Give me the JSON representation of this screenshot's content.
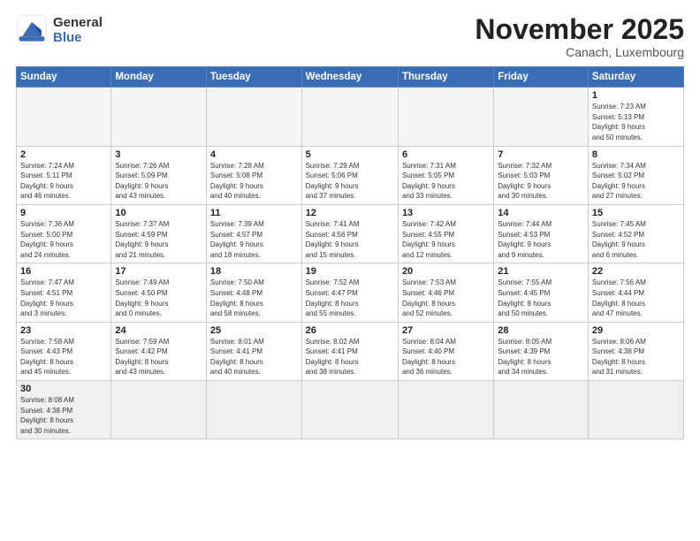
{
  "logo": {
    "line1": "General",
    "line2": "Blue"
  },
  "title": "November 2025",
  "subtitle": "Canach, Luxembourg",
  "weekdays": [
    "Sunday",
    "Monday",
    "Tuesday",
    "Wednesday",
    "Thursday",
    "Friday",
    "Saturday"
  ],
  "weeks": [
    [
      {
        "day": "",
        "info": ""
      },
      {
        "day": "",
        "info": ""
      },
      {
        "day": "",
        "info": ""
      },
      {
        "day": "",
        "info": ""
      },
      {
        "day": "",
        "info": ""
      },
      {
        "day": "",
        "info": ""
      },
      {
        "day": "1",
        "info": "Sunrise: 7:23 AM\nSunset: 5:13 PM\nDaylight: 9 hours\nand 50 minutes."
      }
    ],
    [
      {
        "day": "2",
        "info": "Sunrise: 7:24 AM\nSunset: 5:11 PM\nDaylight: 9 hours\nand 46 minutes."
      },
      {
        "day": "3",
        "info": "Sunrise: 7:26 AM\nSunset: 5:09 PM\nDaylight: 9 hours\nand 43 minutes."
      },
      {
        "day": "4",
        "info": "Sunrise: 7:28 AM\nSunset: 5:08 PM\nDaylight: 9 hours\nand 40 minutes."
      },
      {
        "day": "5",
        "info": "Sunrise: 7:29 AM\nSunset: 5:06 PM\nDaylight: 9 hours\nand 37 minutes."
      },
      {
        "day": "6",
        "info": "Sunrise: 7:31 AM\nSunset: 5:05 PM\nDaylight: 9 hours\nand 33 minutes."
      },
      {
        "day": "7",
        "info": "Sunrise: 7:32 AM\nSunset: 5:03 PM\nDaylight: 9 hours\nand 30 minutes."
      },
      {
        "day": "8",
        "info": "Sunrise: 7:34 AM\nSunset: 5:02 PM\nDaylight: 9 hours\nand 27 minutes."
      }
    ],
    [
      {
        "day": "9",
        "info": "Sunrise: 7:36 AM\nSunset: 5:00 PM\nDaylight: 9 hours\nand 24 minutes."
      },
      {
        "day": "10",
        "info": "Sunrise: 7:37 AM\nSunset: 4:59 PM\nDaylight: 9 hours\nand 21 minutes."
      },
      {
        "day": "11",
        "info": "Sunrise: 7:39 AM\nSunset: 4:57 PM\nDaylight: 9 hours\nand 18 minutes."
      },
      {
        "day": "12",
        "info": "Sunrise: 7:41 AM\nSunset: 4:56 PM\nDaylight: 9 hours\nand 15 minutes."
      },
      {
        "day": "13",
        "info": "Sunrise: 7:42 AM\nSunset: 4:55 PM\nDaylight: 9 hours\nand 12 minutes."
      },
      {
        "day": "14",
        "info": "Sunrise: 7:44 AM\nSunset: 4:53 PM\nDaylight: 9 hours\nand 9 minutes."
      },
      {
        "day": "15",
        "info": "Sunrise: 7:45 AM\nSunset: 4:52 PM\nDaylight: 9 hours\nand 6 minutes."
      }
    ],
    [
      {
        "day": "16",
        "info": "Sunrise: 7:47 AM\nSunset: 4:51 PM\nDaylight: 9 hours\nand 3 minutes."
      },
      {
        "day": "17",
        "info": "Sunrise: 7:49 AM\nSunset: 4:50 PM\nDaylight: 9 hours\nand 0 minutes."
      },
      {
        "day": "18",
        "info": "Sunrise: 7:50 AM\nSunset: 4:48 PM\nDaylight: 8 hours\nand 58 minutes."
      },
      {
        "day": "19",
        "info": "Sunrise: 7:52 AM\nSunset: 4:47 PM\nDaylight: 8 hours\nand 55 minutes."
      },
      {
        "day": "20",
        "info": "Sunrise: 7:53 AM\nSunset: 4:46 PM\nDaylight: 8 hours\nand 52 minutes."
      },
      {
        "day": "21",
        "info": "Sunrise: 7:55 AM\nSunset: 4:45 PM\nDaylight: 8 hours\nand 50 minutes."
      },
      {
        "day": "22",
        "info": "Sunrise: 7:56 AM\nSunset: 4:44 PM\nDaylight: 8 hours\nand 47 minutes."
      }
    ],
    [
      {
        "day": "23",
        "info": "Sunrise: 7:58 AM\nSunset: 4:43 PM\nDaylight: 8 hours\nand 45 minutes."
      },
      {
        "day": "24",
        "info": "Sunrise: 7:59 AM\nSunset: 4:42 PM\nDaylight: 8 hours\nand 43 minutes."
      },
      {
        "day": "25",
        "info": "Sunrise: 8:01 AM\nSunset: 4:41 PM\nDaylight: 8 hours\nand 40 minutes."
      },
      {
        "day": "26",
        "info": "Sunrise: 8:02 AM\nSunset: 4:41 PM\nDaylight: 8 hours\nand 38 minutes."
      },
      {
        "day": "27",
        "info": "Sunrise: 8:04 AM\nSunset: 4:40 PM\nDaylight: 8 hours\nand 36 minutes."
      },
      {
        "day": "28",
        "info": "Sunrise: 8:05 AM\nSunset: 4:39 PM\nDaylight: 8 hours\nand 34 minutes."
      },
      {
        "day": "29",
        "info": "Sunrise: 8:06 AM\nSunset: 4:38 PM\nDaylight: 8 hours\nand 31 minutes."
      }
    ],
    [
      {
        "day": "30",
        "info": "Sunrise: 8:08 AM\nSunset: 4:38 PM\nDaylight: 8 hours\nand 30 minutes."
      },
      {
        "day": "",
        "info": ""
      },
      {
        "day": "",
        "info": ""
      },
      {
        "day": "",
        "info": ""
      },
      {
        "day": "",
        "info": ""
      },
      {
        "day": "",
        "info": ""
      },
      {
        "day": "",
        "info": ""
      }
    ]
  ]
}
